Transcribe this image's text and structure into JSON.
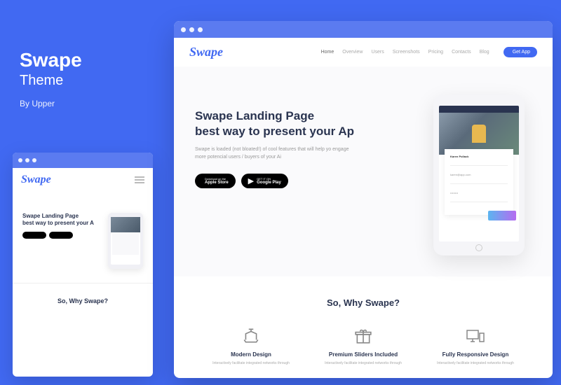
{
  "sidebar": {
    "title": "Swape",
    "subtitle": "Theme",
    "author": "By Upper"
  },
  "logo": "Swape",
  "nav": {
    "items": [
      "Home",
      "Overview",
      "Users",
      "Screenshots",
      "Pricing",
      "Contacts",
      "Blog"
    ],
    "cta": "Get App"
  },
  "hero": {
    "line1": "Swape Landing Page",
    "line2": "best way to present your Ap",
    "sub": "Swape is loaded (not bloated!) of cool features that will help yo engage more potencial users / buyers of your Ai",
    "apple_pre": "Download on the",
    "apple": "Apple Store",
    "google_pre": "GET IT ON",
    "google": "Google Play"
  },
  "mobile_hero": {
    "line1": "Swape Landing Page",
    "line2": "best way to present your A"
  },
  "phone_card": {
    "name_label": "Karen Pollack",
    "email": "karen@app.com"
  },
  "section2": {
    "title": "So, Why Swape?"
  },
  "features": [
    {
      "icon": "ship",
      "title": "Modern Design",
      "desc": "Interactively facilitate integrated networks through"
    },
    {
      "icon": "gift",
      "title": "Premium Sliders Included",
      "desc": "Interactively facilitate integrated networks through"
    },
    {
      "icon": "devices",
      "title": "Fully Responsive Design",
      "desc": "Interactively facilitate integrated networks through"
    }
  ]
}
